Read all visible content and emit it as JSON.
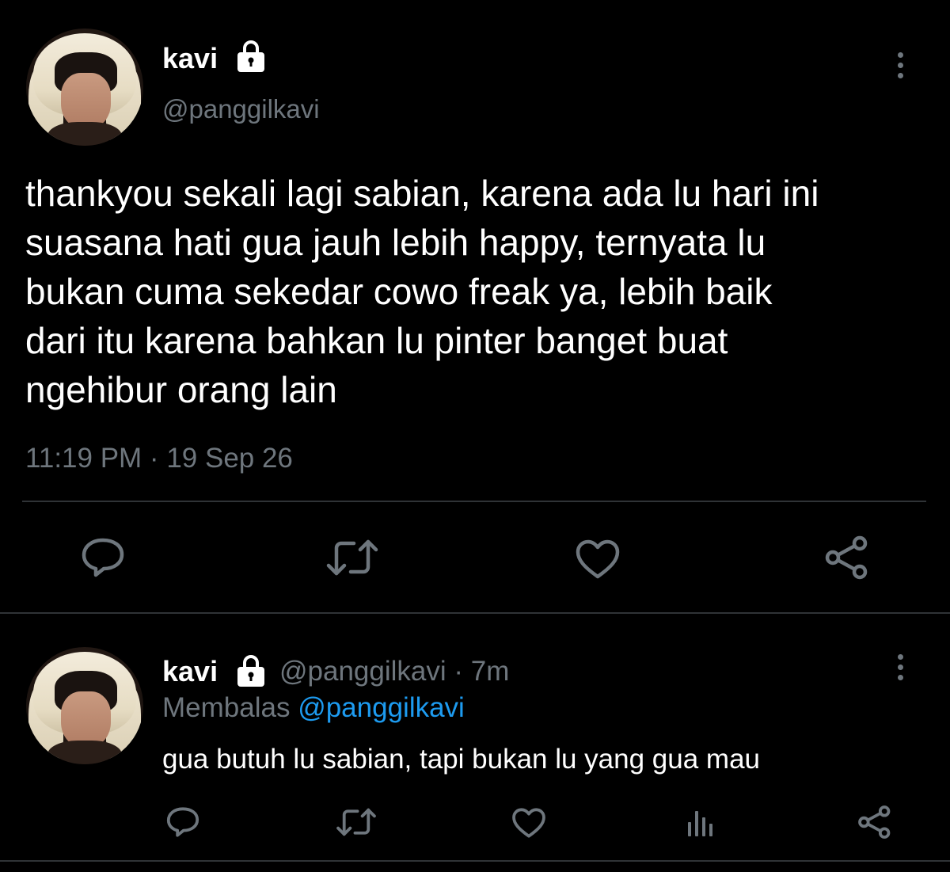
{
  "colors": {
    "background": "#000000",
    "text_primary": "#ffffff",
    "text_secondary": "#6e767d",
    "link": "#1d9bf0",
    "divider": "#2f3336"
  },
  "main_tweet": {
    "display_name": "kavi",
    "protected_icon": "lock-icon",
    "handle": "@panggilkavi",
    "more_icon": "more-vertical-icon",
    "text": "thankyou sekali lagi sabian, karena ada lu hari ini\nsuasana hati gua jauh lebih happy, ternyata lu\nbukan cuma sekedar cowo freak ya, lebih baik\ndari itu karena bahkan lu pinter banget buat\nngehibur orang lain",
    "timestamp": "11:19 PM · 19 Sep 26",
    "actions": [
      {
        "name": "reply",
        "icon": "reply-icon"
      },
      {
        "name": "retweet",
        "icon": "retweet-icon"
      },
      {
        "name": "like",
        "icon": "heart-icon"
      },
      {
        "name": "share",
        "icon": "share-icon"
      }
    ]
  },
  "reply_tweet": {
    "display_name": "kavi",
    "protected_icon": "lock-icon",
    "handle_time": "@panggilkavi · 7m",
    "replying_to_label": "Membalas",
    "replying_to_handle": "@panggilkavi",
    "text": "gua butuh lu sabian, tapi bukan lu yang gua mau",
    "more_icon": "more-vertical-icon",
    "actions": [
      {
        "name": "reply",
        "icon": "reply-icon"
      },
      {
        "name": "retweet",
        "icon": "retweet-icon"
      },
      {
        "name": "like",
        "icon": "heart-icon"
      },
      {
        "name": "analytics",
        "icon": "analytics-icon"
      },
      {
        "name": "share",
        "icon": "share-icon"
      }
    ]
  }
}
